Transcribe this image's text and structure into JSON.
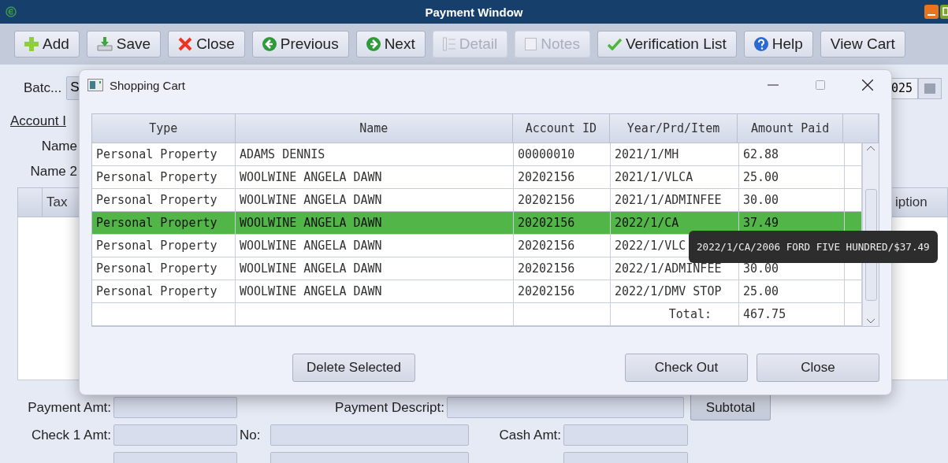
{
  "window": {
    "title": "Payment Window"
  },
  "toolbar": [
    {
      "label": "Add",
      "disabled": false
    },
    {
      "label": "Save",
      "disabled": false
    },
    {
      "label": "Close",
      "disabled": false
    },
    {
      "label": "Previous",
      "disabled": false
    },
    {
      "label": "Next",
      "disabled": false
    },
    {
      "label": "Detail",
      "disabled": true
    },
    {
      "label": "Notes",
      "disabled": true
    },
    {
      "label": "Verification List",
      "disabled": false
    },
    {
      "label": "Help",
      "disabled": false
    },
    {
      "label": "View Cart",
      "disabled": false
    }
  ],
  "form": {
    "batch_label": "Batc...",
    "batch_value": "S",
    "date_value": "025",
    "account_label": "Account I",
    "name_label": "Name",
    "name2_label": "Name 2"
  },
  "grid": {
    "columns": [
      "Tax",
      "iption"
    ]
  },
  "dialog": {
    "title": "Shopping Cart",
    "table": {
      "columns": [
        "Type",
        "Name",
        "Account ID",
        "Year/Prd/Item",
        "Amount Paid"
      ],
      "rows": [
        {
          "cells": [
            "Personal Property",
            "ADAMS DENNIS",
            "00000010",
            "2021/1/MH",
            "62.88"
          ],
          "selected": false
        },
        {
          "cells": [
            "Personal Property",
            "WOOLWINE ANGELA DAWN",
            "20202156",
            "2021/1/VLCA",
            "25.00"
          ],
          "selected": false
        },
        {
          "cells": [
            "Personal Property",
            "WOOLWINE ANGELA DAWN",
            "20202156",
            "2021/1/ADMINFEE",
            "30.00"
          ],
          "selected": false
        },
        {
          "cells": [
            "Personal Property",
            "WOOLWINE ANGELA DAWN",
            "20202156",
            "2022/1/CA",
            "37.49"
          ],
          "selected": true
        },
        {
          "cells": [
            "Personal Property",
            "WOOLWINE ANGELA DAWN",
            "20202156",
            "2022/1/VLC"
          ],
          "selected": false
        },
        {
          "cells": [
            "Personal Property",
            "WOOLWINE ANGELA DAWN",
            "20202156",
            "2022/1/ADMINFEE",
            "30.00"
          ],
          "selected": false
        },
        {
          "cells": [
            "Personal Property",
            "WOOLWINE ANGELA DAWN",
            "20202156",
            "2022/1/DMV STOP",
            "25.00"
          ],
          "selected": false
        }
      ],
      "total": {
        "label": "Total:",
        "value": "467.75"
      }
    },
    "tooltip": "2022/1/CA/2006 FORD FIVE HUNDRED/$37.49",
    "buttons": [
      "Delete Selected",
      "Check Out",
      "Close"
    ]
  },
  "payment": {
    "rows": [
      [
        {
          "kind": "label",
          "text": "Payment Amt:"
        },
        {
          "kind": "field"
        },
        {
          "kind": "label",
          "text": "Payment Descript:"
        },
        {
          "kind": "field"
        },
        {
          "kind": "button",
          "text": "Subtotal"
        }
      ],
      [
        {
          "kind": "label",
          "text": "Check 1 Amt:"
        },
        {
          "kind": "field"
        },
        {
          "kind": "short",
          "text": "No:"
        },
        {
          "kind": "field"
        },
        {
          "kind": "label",
          "text": "Cash Amt:"
        },
        {
          "kind": "field"
        }
      ],
      [
        {
          "kind": "gap"
        },
        {
          "kind": "field"
        },
        {
          "kind": "gap"
        },
        {
          "kind": "field"
        },
        {
          "kind": "gap"
        },
        {
          "kind": "field"
        }
      ]
    ]
  }
}
